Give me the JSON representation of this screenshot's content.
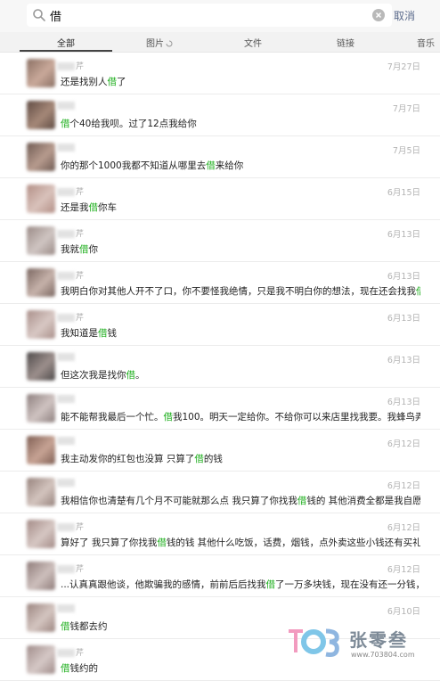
{
  "search": {
    "query": "借",
    "cancel_label": "取消"
  },
  "tabs": [
    {
      "label": "全部",
      "active": true
    },
    {
      "label": "图片",
      "loading": true
    },
    {
      "label": "文件"
    },
    {
      "label": "链接"
    },
    {
      "label": "音乐"
    }
  ],
  "highlight_color": "#1aad19",
  "results": [
    {
      "sender": "芹",
      "date": "7月27日",
      "message": "还是找别人借了"
    },
    {
      "sender": "",
      "date": "7月7日",
      "message": "借个40给我呗。过了12点我给你"
    },
    {
      "sender": "",
      "date": "7月5日",
      "message": "你的那个1000我都不知道从哪里去借来给你"
    },
    {
      "sender": "芹",
      "date": "6月15日",
      "message": "还是我借你车"
    },
    {
      "sender": "芹",
      "date": "6月13日",
      "message": "我就借你"
    },
    {
      "sender": "芹",
      "date": "6月13日",
      "message": "我明白你对其他人开不了口，你不要怪我绝情，只是我不明白你的想法，现在还会找我借钱"
    },
    {
      "sender": "芹",
      "date": "6月13日",
      "message": "我知道是借钱"
    },
    {
      "sender": "",
      "date": "6月13日",
      "message": "但这次我是找你借。"
    },
    {
      "sender": "",
      "date": "6月13日",
      "message": "能不能帮我最后一个忙。借我100。明天一定给你。不给你可以来店里找我要。我蜂鸟弄..."
    },
    {
      "sender": "",
      "date": "6月12日",
      "message": "我主动发你的红包也没算 只算了借的钱"
    },
    {
      "sender": "",
      "date": "6月12日",
      "message": "我相信你也清楚有几个月不可能就那么点 我只算了你找我借钱的 其他消费全都是我自愿 算..."
    },
    {
      "sender": "芹",
      "date": "6月12日",
      "message": "算好了 我只算了你找我借钱的钱 其他什么吃饭，话费，烟钱，点外卖这些小钱还有买礼物..."
    },
    {
      "sender": "芹",
      "date": "6月12日",
      "message": "...认真真跟他谈，他欺骗我的感情，前前后后找我借了一万多块钱，现在没有还一分钱，是..."
    },
    {
      "sender": "",
      "date": "6月10日",
      "message": "借钱都去约"
    },
    {
      "sender": "芹",
      "date": "",
      "message": "借钱约的"
    }
  ],
  "watermark": {
    "name": "张零叁",
    "url": "www.703804.com"
  }
}
